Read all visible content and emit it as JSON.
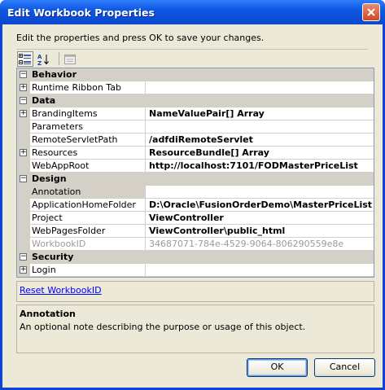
{
  "window": {
    "title": "Edit Workbook Properties"
  },
  "instructions": "Edit the properties and press OK to save your changes.",
  "toolbar": {
    "categorized_icon": "categorized-icon",
    "alphabetical_icon": "alphabetical-icon",
    "property_pages_icon": "property-pages-icon"
  },
  "grid": {
    "categories": [
      {
        "label": "Behavior",
        "expanded": true
      },
      {
        "label": "Data",
        "expanded": true
      },
      {
        "label": "Design",
        "expanded": true
      },
      {
        "label": "Security",
        "expanded": true
      }
    ],
    "rows": {
      "runtime_ribbon_tab": {
        "name": "Runtime Ribbon Tab",
        "value": ""
      },
      "branding_items": {
        "name": "BrandingItems",
        "value": "NameValuePair[] Array"
      },
      "parameters": {
        "name": "Parameters",
        "value": ""
      },
      "remote_servlet_path": {
        "name": "RemoteServletPath",
        "value": "/adfdiRemoteServlet"
      },
      "resources": {
        "name": "Resources",
        "value": "ResourceBundle[] Array"
      },
      "web_app_root": {
        "name": "WebAppRoot",
        "value": "http://localhost:7101/FODMasterPriceList"
      },
      "annotation": {
        "name": "Annotation",
        "value": ""
      },
      "application_home_folder": {
        "name": "ApplicationHomeFolder",
        "value": "D:\\Oracle\\FusionOrderDemo\\MasterPriceList"
      },
      "project": {
        "name": "Project",
        "value": "ViewController"
      },
      "web_pages_folder": {
        "name": "WebPagesFolder",
        "value": "ViewController\\public_html"
      },
      "workbook_id": {
        "name": "WorkbookID",
        "value": "34687071-784e-4529-9064-806290559e8e"
      },
      "login": {
        "name": "Login",
        "value": ""
      }
    }
  },
  "reset_link": "Reset WorkbookID",
  "description": {
    "title": "Annotation",
    "text": "An optional note describing the purpose or usage of this object."
  },
  "buttons": {
    "ok": "OK",
    "cancel": "Cancel"
  },
  "colors": {
    "title_bar": "#0a4cd6",
    "client_bg": "#ece9d8",
    "category_bg": "#d4d0c8",
    "link": "#0000ff"
  }
}
